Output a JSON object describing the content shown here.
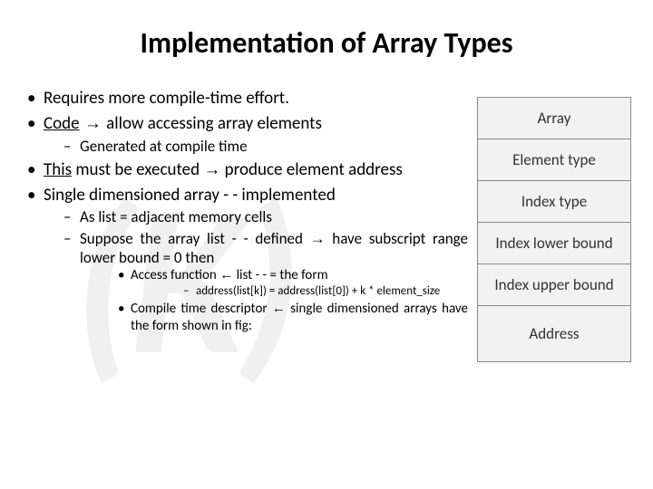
{
  "title": "Implementation of Array Types",
  "watermark": "(K)",
  "bullets": {
    "b1": "Requires more compile-time effort.",
    "b2_code": "Code",
    "b2_rest": " allow accessing array elements",
    "b2_sub1": "Generated at compile time",
    "b3_this": "This",
    "b3_rest": " must be executed ",
    "b3_after": " produce element address",
    "b4": "Single dimensioned array - - implemented",
    "b4_sub1": "As list = adjacent memory cells",
    "b4_sub2": "Suppose the array list - - defined ",
    "b4_sub2_after": " have subscript range lower bound = 0 then",
    "b4_sub2_a": "Access function ",
    "b4_sub2_a_after": " list - - = the form",
    "b4_sub2_a_i": "address(list[k]) = address(list[0]) + k * element_size",
    "b4_sub2_b": "Compile time descriptor ",
    "b4_sub2_b_after": " single dimensioned arrays have the form shown in fig:"
  },
  "arrow_right": "→",
  "arrow_left": "←",
  "sidebox": {
    "r1": "Array",
    "r2": "Element type",
    "r3": "Index type",
    "r4": "Index lower bound",
    "r5": "Index upper bound",
    "r6": "Address"
  }
}
